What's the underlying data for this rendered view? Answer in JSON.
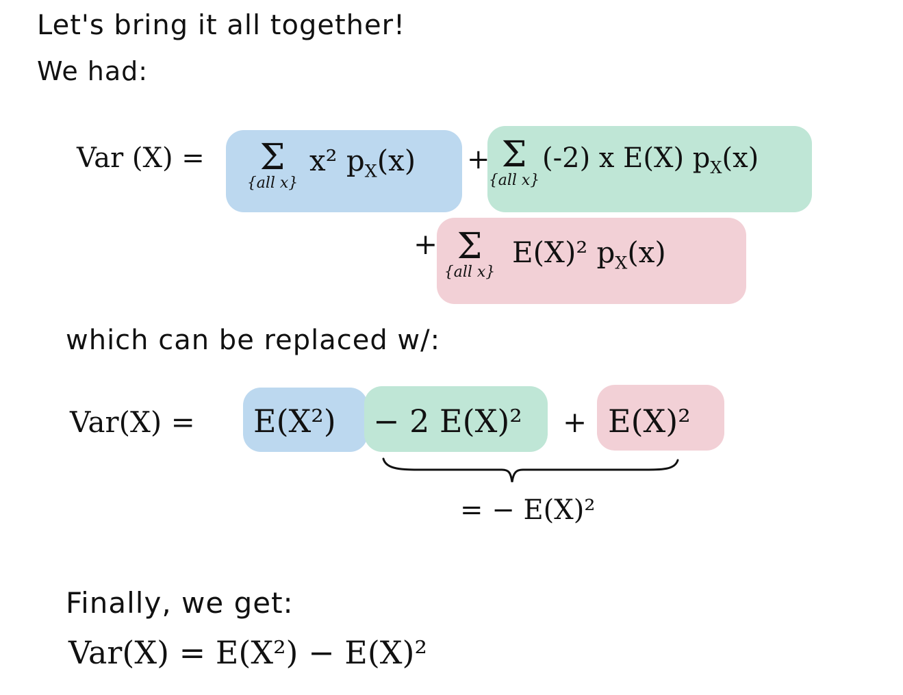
{
  "intro": {
    "line1": "Let's bring it all together!",
    "line2": "We had:"
  },
  "eq1": {
    "lhs": "Var (X) =",
    "sum_symbol": "Σ",
    "sum_index": "{all x}",
    "term1": "x² p",
    "term1_sub": "X",
    "term1_tail": "(x)",
    "plus1": "+",
    "term2": "(-2) x E(X) p",
    "term2_sub": "X",
    "term2_tail": "(x)",
    "plus2": "+",
    "term3": "E(X)² p",
    "term3_sub": "X",
    "term3_tail": "(x)"
  },
  "replace_text": "which can be replaced w/:",
  "eq2": {
    "lhs": "Var(X) =",
    "blue": "E(X²)",
    "green": "− 2 E(X)²",
    "plus": "+",
    "pink": "E(X)²",
    "brace_note": "= − E(X)²"
  },
  "final": {
    "text": "Finally, we get:",
    "equation": "Var(X) = E(X²) − E(X)²"
  },
  "colors": {
    "blue": "#bcd8ef",
    "green": "#bfe6d6",
    "pink": "#f2d0d6"
  }
}
